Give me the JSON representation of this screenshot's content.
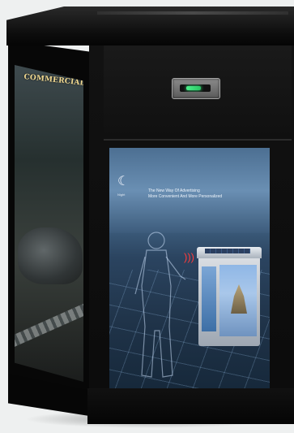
{
  "side_display": {
    "headline": "COMMERCIAL VALUE"
  },
  "front_display": {
    "mode_icon": "moon-icon",
    "mode_label": "Night",
    "tagline_line1": "The New Way Of Advertising",
    "tagline_line2": "More Convenient And More Personalized",
    "gesture_icon": "wave-signal-icon"
  },
  "sensor": {
    "indicator_color": "#3ef088"
  },
  "colors": {
    "cabinet": "#0b0b0b",
    "screen_sky": "#4c6f92",
    "signal": "#ff3b3b"
  }
}
